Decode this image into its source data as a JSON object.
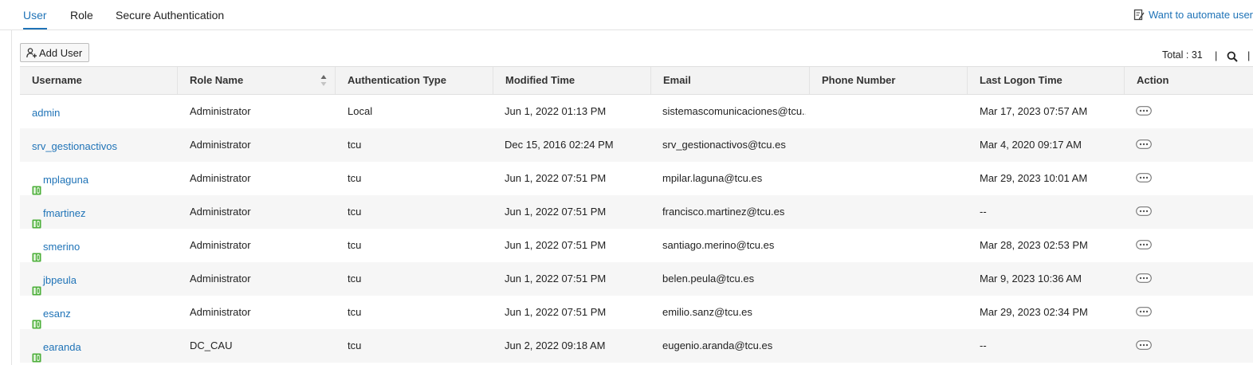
{
  "tabs": [
    {
      "label": "User",
      "active": true
    },
    {
      "label": "Role",
      "active": false
    },
    {
      "label": "Secure Authentication",
      "active": false
    }
  ],
  "automate_link": "Want to automate user",
  "toolbar": {
    "add_user_label": "Add User",
    "total_label": "Total : 31",
    "separator": "|"
  },
  "columns": [
    "Username",
    "Role Name",
    "Authentication Type",
    "Modified Time",
    "Email",
    "Phone Number",
    "Last Logon Time",
    "Action"
  ],
  "rows": [
    {
      "username": "admin",
      "ad_user": false,
      "role": "Administrator",
      "auth": "Local",
      "modified": "Jun 1, 2022 01:13 PM",
      "email": "sistemascomunicaciones@tcu....",
      "phone": "",
      "last_logon": "Mar 17, 2023 07:57 AM"
    },
    {
      "username": "srv_gestionactivos",
      "ad_user": false,
      "role": "Administrator",
      "auth": "tcu",
      "modified": "Dec 15, 2016 02:24 PM",
      "email": "srv_gestionactivos@tcu.es",
      "phone": "",
      "last_logon": "Mar 4, 2020 09:17 AM"
    },
    {
      "username": "mplaguna",
      "ad_user": true,
      "role": "Administrator",
      "auth": "tcu",
      "modified": "Jun 1, 2022 07:51 PM",
      "email": "mpilar.laguna@tcu.es",
      "phone": "",
      "last_logon": "Mar 29, 2023 10:01 AM"
    },
    {
      "username": "fmartinez",
      "ad_user": true,
      "role": "Administrator",
      "auth": "tcu",
      "modified": "Jun 1, 2022 07:51 PM",
      "email": "francisco.martinez@tcu.es",
      "phone": "",
      "last_logon": "--"
    },
    {
      "username": "smerino",
      "ad_user": true,
      "role": "Administrator",
      "auth": "tcu",
      "modified": "Jun 1, 2022 07:51 PM",
      "email": "santiago.merino@tcu.es",
      "phone": "",
      "last_logon": "Mar 28, 2023 02:53 PM"
    },
    {
      "username": "jbpeula",
      "ad_user": true,
      "role": "Administrator",
      "auth": "tcu",
      "modified": "Jun 1, 2022 07:51 PM",
      "email": "belen.peula@tcu.es",
      "phone": "",
      "last_logon": "Mar 9, 2023 10:36 AM"
    },
    {
      "username": "esanz",
      "ad_user": true,
      "role": "Administrator",
      "auth": "tcu",
      "modified": "Jun 1, 2022 07:51 PM",
      "email": "emilio.sanz@tcu.es",
      "phone": "",
      "last_logon": "Mar 29, 2023 02:34 PM"
    },
    {
      "username": "earanda",
      "ad_user": true,
      "role": "DC_CAU",
      "auth": "tcu",
      "modified": "Jun 2, 2022 09:18 AM",
      "email": "eugenio.aranda@tcu.es",
      "phone": "",
      "last_logon": "--"
    }
  ],
  "icons": {
    "automate": "edit-document-icon",
    "add_user": "add-user-icon",
    "search": "search-icon",
    "sort": "sort-icon",
    "ad_user": "ad-user-icon",
    "action": "more-options-icon"
  },
  "colors": {
    "accent": "#1f73b7",
    "header_bg": "#f3f3f3",
    "alt_row_bg": "#f6f6f6",
    "ad_icon_green": "#4caf3a"
  }
}
